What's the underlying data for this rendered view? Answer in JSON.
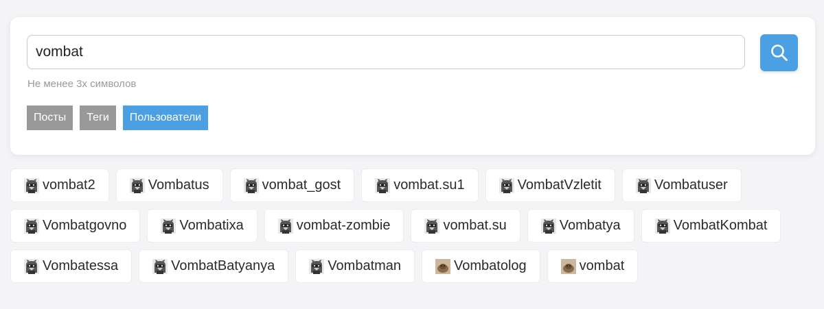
{
  "search": {
    "value": "vombat",
    "hint": "Не менее 3х символов",
    "button_icon": "search-icon"
  },
  "filters": [
    {
      "label": "Посты",
      "active": false
    },
    {
      "label": "Теги",
      "active": false
    },
    {
      "label": "Пользователи",
      "active": true
    }
  ],
  "colors": {
    "accent": "#4aa0e2",
    "inactive_filter": "#999999",
    "page_bg": "#f4f4f7"
  },
  "users": [
    [
      {
        "name": "vombat2",
        "avatar": "raccoon-avatar"
      },
      {
        "name": "Vombatus",
        "avatar": "raccoon-avatar"
      },
      {
        "name": "vombat_gost",
        "avatar": "raccoon-avatar"
      },
      {
        "name": "vombat.su1",
        "avatar": "raccoon-avatar"
      },
      {
        "name": "VombatVzletit",
        "avatar": "raccoon-avatar"
      },
      {
        "name": "Vombatuser",
        "avatar": "raccoon-avatar"
      }
    ],
    [
      {
        "name": "Vombatgovno",
        "avatar": "raccoon-avatar"
      },
      {
        "name": "Vombatixa",
        "avatar": "raccoon-avatar"
      },
      {
        "name": "vombat-zombie",
        "avatar": "raccoon-avatar"
      },
      {
        "name": "vombat.su",
        "avatar": "raccoon-avatar"
      },
      {
        "name": "Vombatya",
        "avatar": "raccoon-avatar"
      },
      {
        "name": "VombatKombat",
        "avatar": "raccoon-avatar"
      }
    ],
    [
      {
        "name": "Vombatessa",
        "avatar": "raccoon-avatar"
      },
      {
        "name": "VombatBatyanya",
        "avatar": "raccoon-avatar"
      },
      {
        "name": "Vombatman",
        "avatar": "raccoon-avatar"
      },
      {
        "name": "Vombatolog",
        "avatar": "wombat-photo-avatar"
      },
      {
        "name": "vombat",
        "avatar": "wombat-photo-avatar"
      }
    ]
  ]
}
